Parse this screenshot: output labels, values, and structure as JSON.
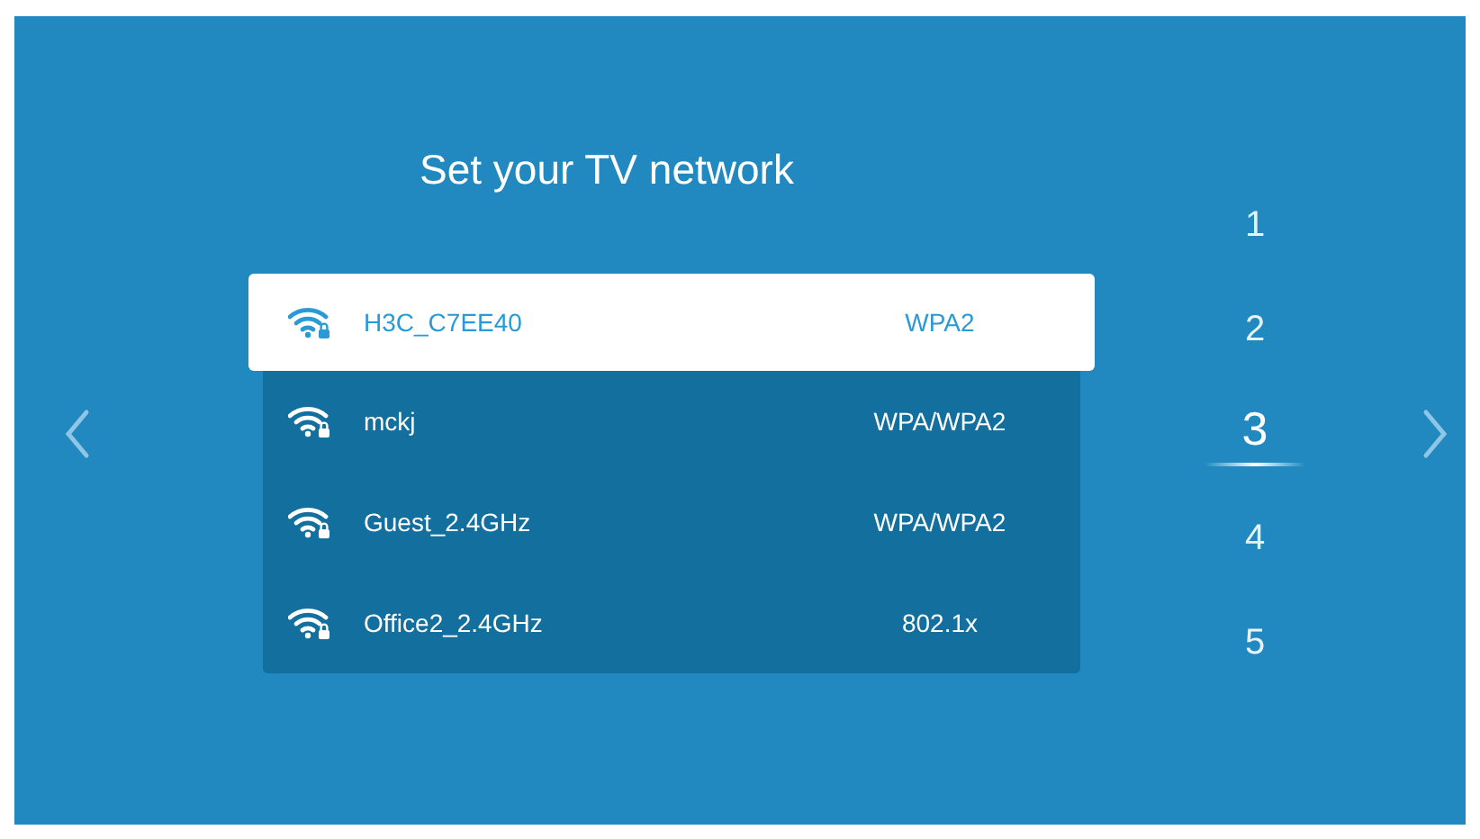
{
  "title": "Set your TV network",
  "networks": [
    {
      "name": "H3C_C7EE40",
      "security": "WPA2",
      "selected": true
    },
    {
      "name": "mckj",
      "security": "WPA/WPA2",
      "selected": false
    },
    {
      "name": "Guest_2.4GHz",
      "security": "WPA/WPA2",
      "selected": false
    },
    {
      "name": "Office2_2.4GHz",
      "security": "802.1x",
      "selected": false
    }
  ],
  "steps": [
    {
      "label": "1",
      "selected": false
    },
    {
      "label": "2",
      "selected": false
    },
    {
      "label": "3",
      "selected": true
    },
    {
      "label": "4",
      "selected": false
    },
    {
      "label": "5",
      "selected": false
    }
  ]
}
